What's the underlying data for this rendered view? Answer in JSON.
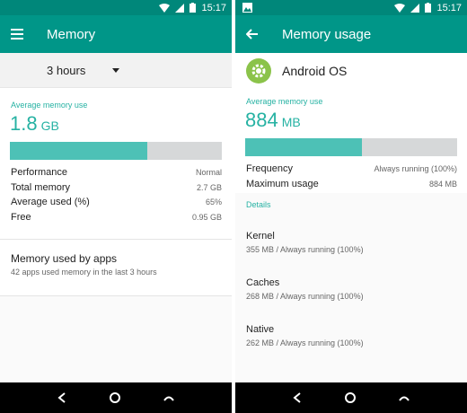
{
  "left": {
    "status_bar": {
      "time": "15:17",
      "icons": [
        "wifi-icon",
        "signal-icon",
        "battery-icon"
      ]
    },
    "app_bar": {
      "menu_icon": "hamburger-menu-icon",
      "title": "Memory"
    },
    "spinner": {
      "selected": "3 hours",
      "icon": "dropdown-arrow-icon"
    },
    "summary": {
      "label": "Average memory use",
      "value": "1.8",
      "unit": "GB",
      "usage_fraction": 0.65,
      "stats": [
        {
          "label": "Performance",
          "value": "Normal"
        },
        {
          "label": "Total memory",
          "value": "2.7 GB"
        },
        {
          "label": "Average used (%)",
          "value": "65%"
        },
        {
          "label": "Free",
          "value": "0.95 GB"
        }
      ]
    },
    "apps": {
      "title": "Memory used by apps",
      "subtitle": "42 apps used memory in the last 3 hours"
    },
    "nav_bar": [
      "back-icon",
      "home-icon",
      "recents-icon"
    ]
  },
  "right": {
    "status_bar": {
      "time": "15:17",
      "icons": [
        "image-notification-icon",
        "wifi-icon",
        "signal-icon",
        "battery-icon"
      ]
    },
    "app_bar": {
      "back_icon": "arrow-back-icon",
      "title": "Memory usage"
    },
    "app": {
      "icon": "android-os-gear-icon",
      "name": "Android OS"
    },
    "summary": {
      "label": "Average memory use",
      "value": "884",
      "unit": "MB",
      "usage_fraction": 0.55,
      "stats": [
        {
          "label": "Frequency",
          "value": "Always running (100%)"
        },
        {
          "label": "Maximum usage",
          "value": "884 MB"
        }
      ]
    },
    "details_label": "Details",
    "details": [
      {
        "title": "Kernel",
        "subtitle": "355 MB / Always running (100%)"
      },
      {
        "title": "Caches",
        "subtitle": "268 MB / Always running (100%)"
      },
      {
        "title": "Native",
        "subtitle": "262 MB / Always running (100%)"
      }
    ],
    "nav_bar": [
      "back-icon",
      "home-icon",
      "recents-icon"
    ]
  },
  "colors": {
    "status_bar": "#00877a",
    "app_bar": "#009688",
    "accent": "#26b2a3",
    "bar_fill": "#4dc1b6",
    "bar_track": "#d6d8d9",
    "app_icon": "#8bc34a"
  }
}
